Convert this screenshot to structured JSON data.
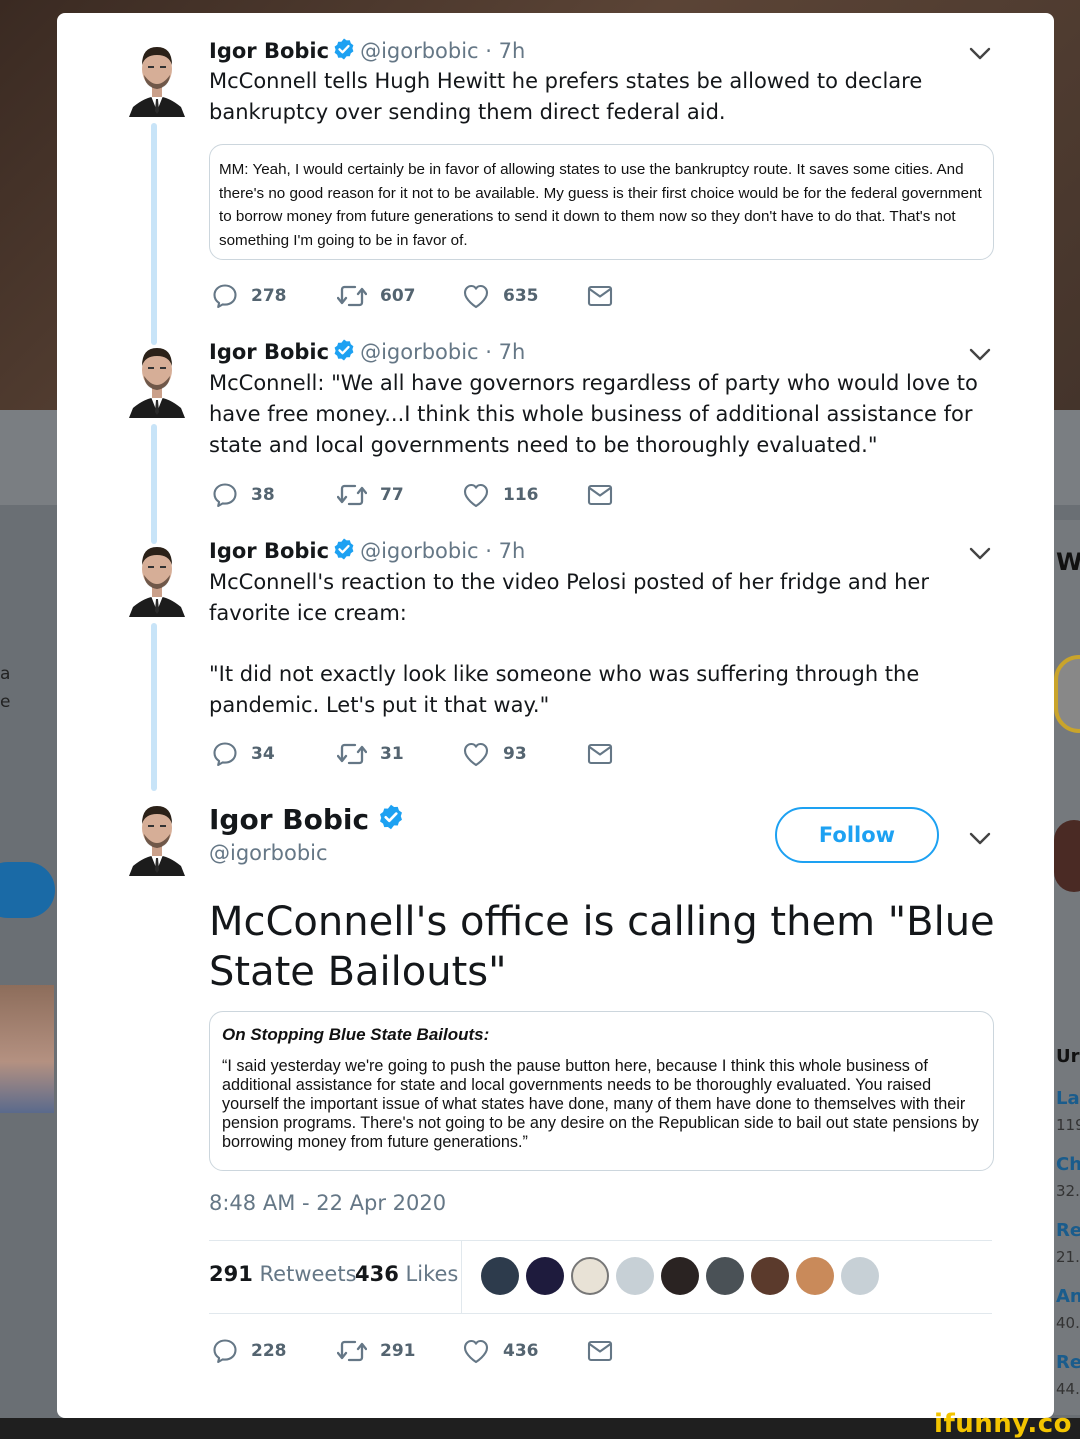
{
  "author": {
    "name": "Igor Bobic",
    "handle": "@igorbobic",
    "time": "· 7h"
  },
  "thread": [
    {
      "text": "McConnell tells Hugh Hewitt he prefers states be allowed to declare bankruptcy over sending them direct federal aid.",
      "quote": "MM: Yeah, I would certainly be in favor of allowing states to use the bankruptcy route. It saves some cities. And there's no good reason for it not to be available. My guess is their first choice would be for the federal government to borrow money from future generations to send it down to them now so they don't have to do that. That's not something I'm going to be in favor of.",
      "replies": "278",
      "retweets": "607",
      "likes": "635"
    },
    {
      "text": "McConnell: \"We all have governors regardless of party who would love to have free money...I think this whole business of additional assistance for state and local governments need to be thoroughly evaluated.\"",
      "replies": "38",
      "retweets": "77",
      "likes": "116"
    },
    {
      "text_line1": "McConnell's reaction to the video Pelosi posted of her fridge and her favorite ice cream:",
      "text_line2": "\"It did not exactly look like someone who was suffering through the pandemic. Let's put it that way.\"",
      "replies": "34",
      "retweets": "31",
      "likes": "93"
    }
  ],
  "main": {
    "follow_label": "Follow",
    "text": "McConnell's office is calling them \"Blue State Bailouts\"",
    "quote_title": "On Stopping Blue State Bailouts:",
    "quote_body": "“I said yesterday we're going to push the pause button here, because I think this whole business of additional assistance for state and local governments needs to be thoroughly evaluated. You raised yourself the important issue of what states have done, many of them have done to themselves with their pension programs. There's not going to be any desire on the Republican side to bail out state pensions by borrowing money from future generations.”",
    "timestamp": "8:48 AM - 22 Apr 2020",
    "retweet_count": "291",
    "retweet_label": "Retweets",
    "like_count": "436",
    "like_label": "Likes",
    "replies": "228",
    "retweets": "291",
    "likes": "436"
  },
  "background": {
    "left_text_1": "a",
    "left_text_2": "e",
    "right_letter": "W",
    "right_items": [
      {
        "link": "Ur",
        "num": ""
      },
      {
        "link": "La",
        "num": "119"
      },
      {
        "link": "Ch",
        "num": "32."
      },
      {
        "link": "Re",
        "num": "21."
      },
      {
        "link": "An",
        "num": "40."
      },
      {
        "link": "Re",
        "num": "44."
      }
    ]
  },
  "watermark": "ifunny.co",
  "colors": {
    "twitter_blue": "#1da1f2",
    "thread_line": "#c8e4f8",
    "muted_text": "#657786"
  },
  "icons": [
    "reply-icon",
    "retweet-icon",
    "like-icon",
    "message-icon",
    "verified-icon",
    "chevron-down-icon"
  ]
}
